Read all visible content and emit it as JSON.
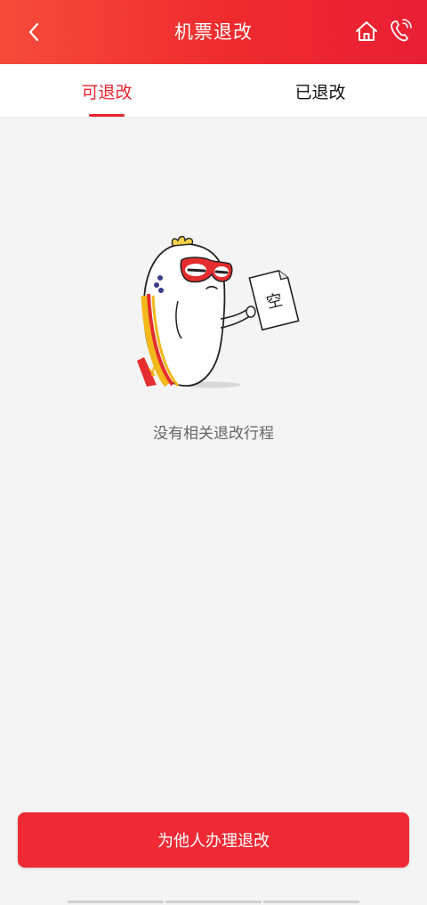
{
  "header": {
    "title": "机票退改",
    "background_color": "#ef2a2e",
    "icons": [
      "back-arrow-icon",
      "home-icon",
      "phone-icon"
    ]
  },
  "tabs": [
    {
      "label": "可退改",
      "active": true
    },
    {
      "label": "已退改",
      "active": false
    }
  ],
  "accent_color": "#e8242f",
  "empty_state": {
    "illustration": "mascot-holding-empty-paper",
    "paper_text": "空",
    "message": "没有相关退改行程"
  },
  "action_button": {
    "label": "为他人办理退改"
  }
}
